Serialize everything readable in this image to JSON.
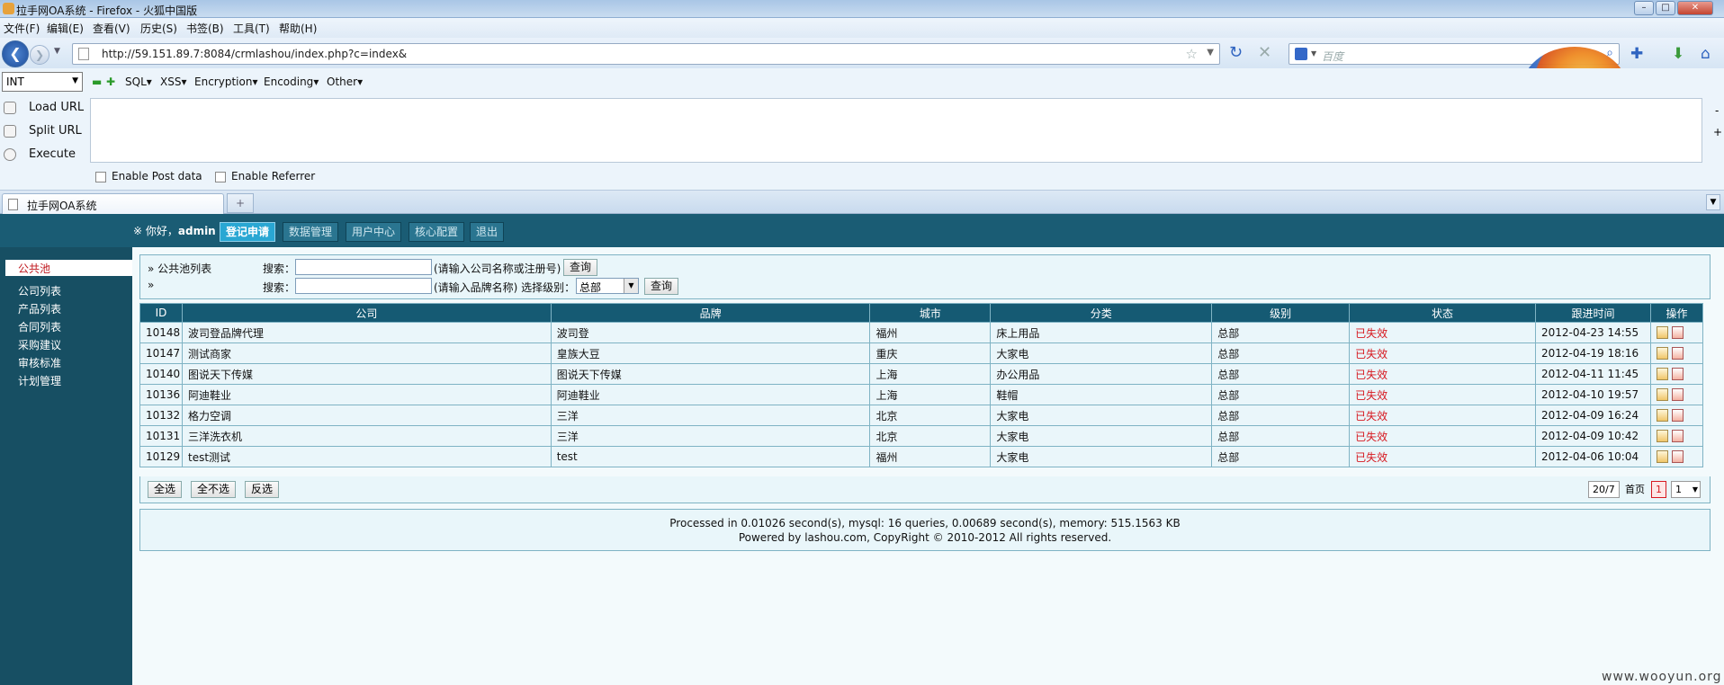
{
  "window": {
    "title": "拉手网OA系统 - Firefox - 火狐中国版",
    "min": "–",
    "max": "□",
    "close": "✕"
  },
  "menu": [
    "文件(F)",
    "编辑(E)",
    "查看(V)",
    "历史(S)",
    "书签(B)",
    "工具(T)",
    "帮助(H)"
  ],
  "nav": {
    "url": "http://59.151.89.7:8084/crmlashou/index.php?c=index&",
    "search_placeholder": "百度"
  },
  "hackbar": {
    "type_select": "INT",
    "menus": [
      "SQL",
      "XSS",
      "Encryption",
      "Encoding",
      "Other"
    ],
    "buttons": [
      "Load URL",
      "Split URL",
      "Execute"
    ],
    "options": [
      "Enable Post data",
      "Enable Referrer"
    ],
    "side_minus": "-",
    "side_plus": "+"
  },
  "tab": {
    "label": "拉手网OA系统",
    "new_tab": "+"
  },
  "app": {
    "greeting_prefix": "※ 你好，",
    "user": "admin",
    "tabs": [
      "登记申请",
      "数据管理",
      "用户中心",
      "核心配置",
      "退出"
    ],
    "active_tab": 0,
    "sidebar": [
      "公共池",
      "公司列表",
      "产品列表",
      "合同列表",
      "采购建议",
      "审核标准",
      "计划管理"
    ],
    "active_sidebar": 0
  },
  "search": {
    "row1_title": "» 公共池列表",
    "row2_title": "»",
    "label": "搜索：",
    "row1_hint": "(请输入公司名称或注册号)",
    "row2_hint": "(请输入品牌名称) 选择级别：",
    "level_value": "总部",
    "query_btn": "查询"
  },
  "table": {
    "columns": [
      "ID",
      "公司",
      "品牌",
      "城市",
      "分类",
      "级别",
      "状态",
      "跟进时间",
      "操作"
    ],
    "rows": [
      {
        "id": "10148",
        "company": "波司登品牌代理",
        "brand": "波司登",
        "city": "福州",
        "category": "床上用品",
        "level": "总部",
        "status": "已失效",
        "time": "2012-04-23 14:55"
      },
      {
        "id": "10147",
        "company": "测试商家",
        "brand": "皇族大豆",
        "city": "重庆",
        "category": "大家电",
        "level": "总部",
        "status": "已失效",
        "time": "2012-04-19 18:16"
      },
      {
        "id": "10140",
        "company": "图说天下传媒",
        "brand": "图说天下传媒",
        "city": "上海",
        "category": "办公用品",
        "level": "总部",
        "status": "已失效",
        "time": "2012-04-11 11:45"
      },
      {
        "id": "10136",
        "company": "阿迪鞋业",
        "brand": "阿迪鞋业",
        "city": "上海",
        "category": "鞋帽",
        "level": "总部",
        "status": "已失效",
        "time": "2012-04-10 19:57"
      },
      {
        "id": "10132",
        "company": "格力空调",
        "brand": "三洋",
        "city": "北京",
        "category": "大家电",
        "level": "总部",
        "status": "已失效",
        "time": "2012-04-09 16:24"
      },
      {
        "id": "10131",
        "company": "三洋洗衣机",
        "brand": "三洋",
        "city": "北京",
        "category": "大家电",
        "level": "总部",
        "status": "已失效",
        "time": "2012-04-09 10:42"
      },
      {
        "id": "10129",
        "company": "test测试",
        "brand": "test",
        "city": "福州",
        "category": "大家电",
        "level": "总部",
        "status": "已失效",
        "time": "2012-04-06 10:04"
      }
    ]
  },
  "bulk": {
    "select_all": "全选",
    "select_none": "全不选",
    "invert": "反选"
  },
  "pager": {
    "summary": "20/7",
    "first": "首页",
    "current": "1",
    "select": "1"
  },
  "footer": {
    "line1": "Processed in 0.01026 second(s), mysql: 16 queries, 0.00689 second(s), memory: 515.1563 KB",
    "line2": "Powered by lashou.com, CopyRight © 2010-2012 All rights reserved."
  },
  "watermark": "www.wooyun.org",
  "colors": {
    "header": "#1a5c74",
    "sidebar": "#174f63",
    "active_tab": "#29a7d3",
    "status_red": "#d71920"
  }
}
